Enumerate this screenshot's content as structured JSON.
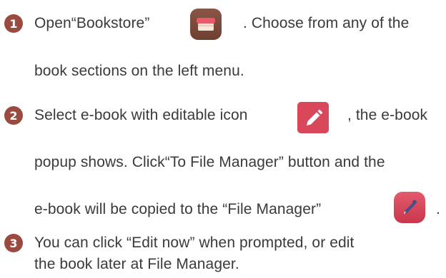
{
  "steps": [
    {
      "number": "1",
      "lines": [
        {
          "before": "Open“Bookstore”",
          "after": ". Choose from any of the"
        },
        {
          "text": "book sections on the left menu."
        }
      ],
      "icon": "bookstore-icon"
    },
    {
      "number": "2",
      "lines": [
        {
          "before": "Select e-book with editable icon",
          "after": ", the e-book"
        },
        {
          "text": "popup shows. Click“To File Manager” button and the"
        },
        {
          "before": "e-book will be copied to the “File Manager”",
          "after": "."
        }
      ],
      "icons": [
        "editable-pencil-icon",
        "file-manager-icon"
      ]
    },
    {
      "number": "3",
      "lines": [
        {
          "text": "You can click “Edit now” when prompted, or edit"
        },
        {
          "text": "the book later at File Manager."
        }
      ]
    }
  ],
  "colors": {
    "badge": "#9a4a3f",
    "text": "#3a3a3a",
    "bookstore_icon": "#7a4a3a",
    "pencil_icon": "#d9475a",
    "file_manager_icon": "#d9475a"
  }
}
